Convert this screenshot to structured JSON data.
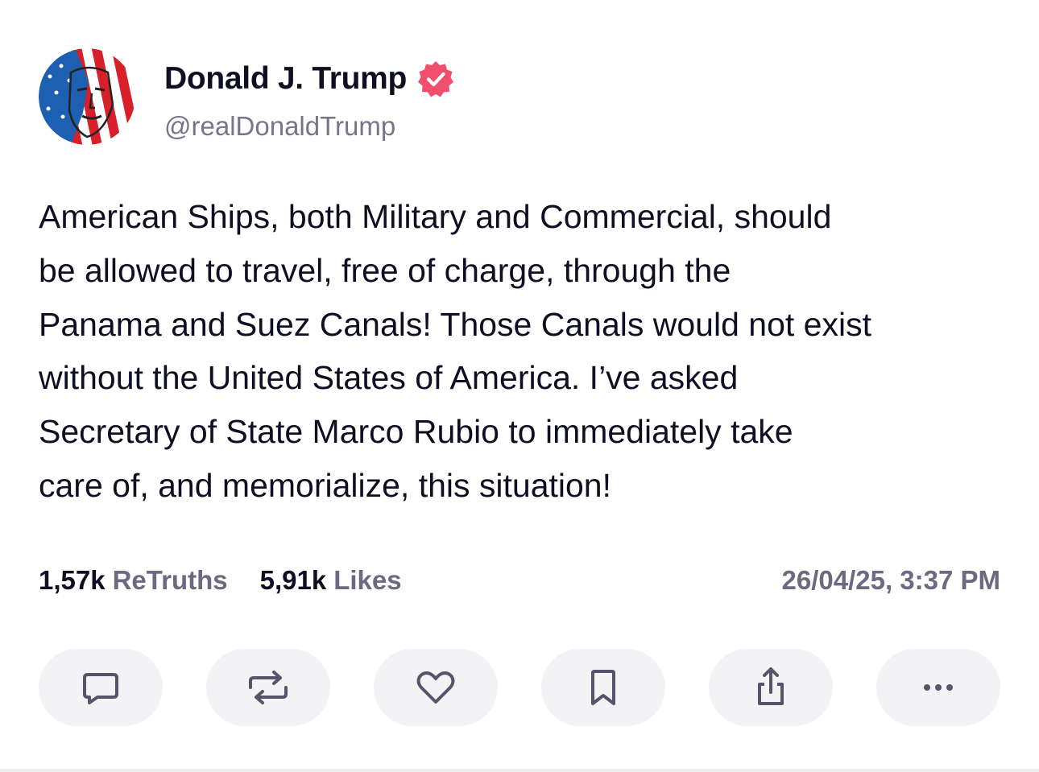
{
  "author": {
    "display_name": "Donald J. Trump",
    "handle": "@realDonaldTrump",
    "verified": true,
    "verified_badge_color": "#f0506e",
    "avatar_icon": "flag-portrait-avatar"
  },
  "post": {
    "text": "American Ships, both Military and Commercial, should\nbe allowed to travel, free of charge, through the\nPanama and Suez Canals! Those Canals would not exist\nwithout the United States of America. I’ve asked\nSecretary of State Marco Rubio to immediately take\ncare of, and memorialize, this situation!"
  },
  "stats": {
    "retruths_count": "1,57k",
    "retruths_label": "ReTruths",
    "likes_count": "5,91k",
    "likes_label": "Likes"
  },
  "timestamp": "26/04/25, 3:37 PM",
  "actions": [
    {
      "name": "reply",
      "icon": "comment-icon"
    },
    {
      "name": "retruth",
      "icon": "repost-icon"
    },
    {
      "name": "like",
      "icon": "heart-icon"
    },
    {
      "name": "bookmark",
      "icon": "bookmark-icon"
    },
    {
      "name": "share",
      "icon": "share-icon"
    },
    {
      "name": "more",
      "icon": "more-icon"
    }
  ],
  "colors": {
    "text_primary": "#0f0f23",
    "text_secondary": "#6b6a80",
    "button_bg": "#f3f3f6",
    "icon_color": "#55546b"
  }
}
